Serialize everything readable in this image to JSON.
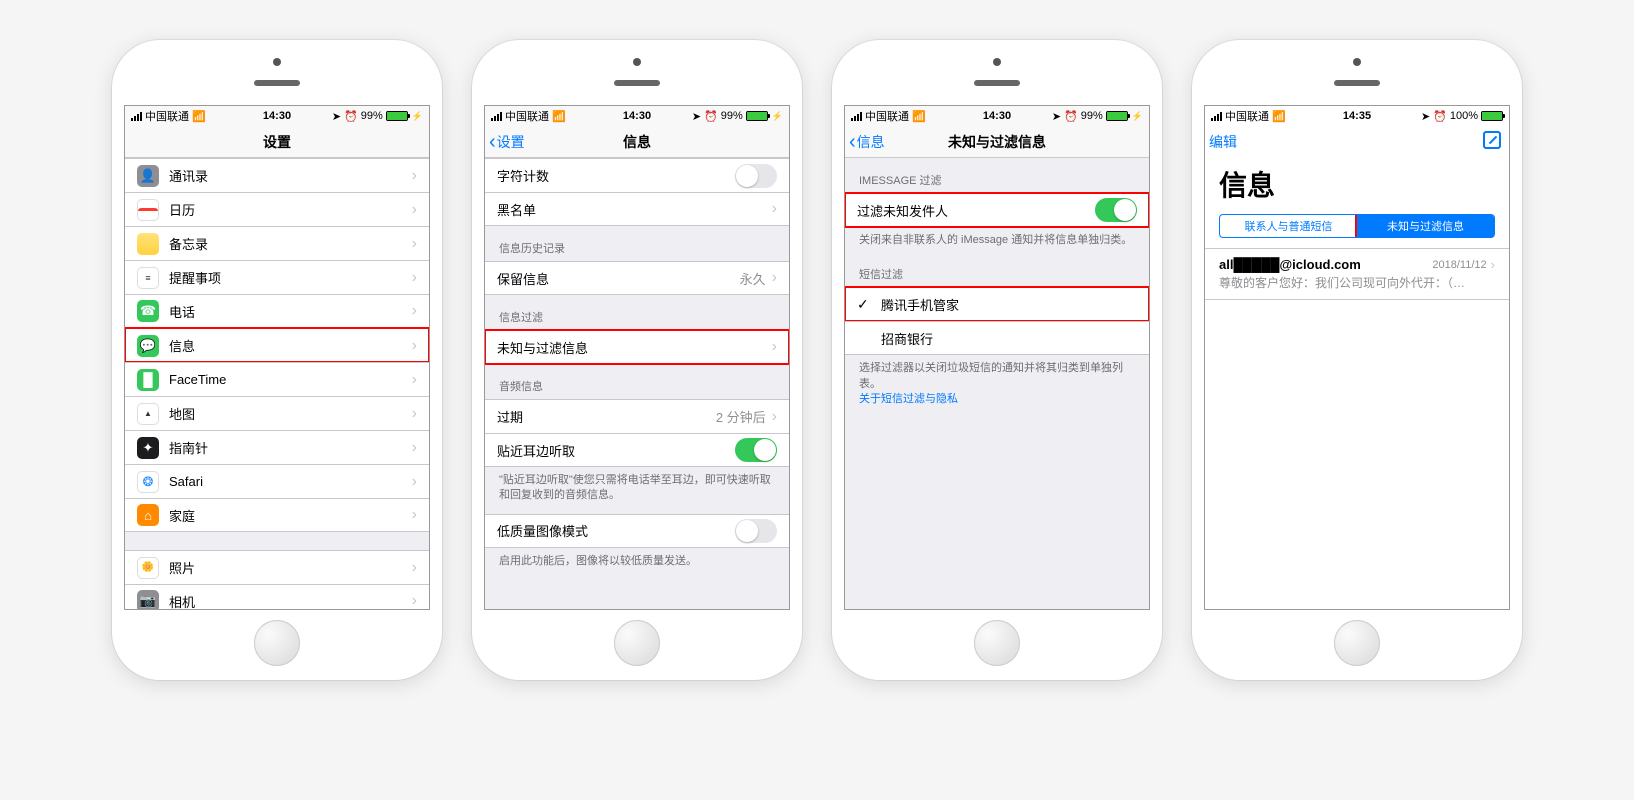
{
  "status": {
    "carrier": "中国联通",
    "time1": "14:30",
    "time4": "14:35",
    "battery1": "99%",
    "battery4": "100%"
  },
  "screen1": {
    "title": "设置",
    "items": [
      {
        "label": "通讯录"
      },
      {
        "label": "日历"
      },
      {
        "label": "备忘录"
      },
      {
        "label": "提醒事项"
      },
      {
        "label": "电话"
      },
      {
        "label": "信息"
      },
      {
        "label": "FaceTime"
      },
      {
        "label": "地图"
      },
      {
        "label": "指南针"
      },
      {
        "label": "Safari"
      },
      {
        "label": "家庭"
      },
      {
        "label": "照片"
      },
      {
        "label": "相机"
      }
    ]
  },
  "screen2": {
    "back": "设置",
    "title": "信息",
    "charCount": "字符计数",
    "blacklist": "黑名单",
    "historyHeader": "信息历史记录",
    "keepMessages": "保留信息",
    "keepValue": "永久",
    "filterHeader": "信息过滤",
    "unknownFilter": "未知与过滤信息",
    "audioHeader": "音频信息",
    "expire": "过期",
    "expireValue": "2 分钟后",
    "raiseListen": "贴近耳边听取",
    "raiseNote": "\"贴近耳边听取\"使您只需将电话举至耳边，即可快速听取和回复收到的音频信息。",
    "lowQuality": "低质量图像模式",
    "lowQualityNote": "启用此功能后，图像将以较低质量发送。"
  },
  "screen3": {
    "back": "信息",
    "title": "未知与过滤信息",
    "imsgHeader": "IMESSAGE 过滤",
    "filterUnknown": "过滤未知发件人",
    "filterNote": "关闭来自非联系人的 iMessage 通知并将信息单独归类。",
    "smsHeader": "短信过滤",
    "tencent": "腾讯手机管家",
    "cmb": "招商银行",
    "smsNote": "选择过滤器以关闭垃圾短信的通知并将其归类到单独列表。",
    "smsLink": "关于短信过滤与隐私"
  },
  "screen4": {
    "edit": "编辑",
    "title": "信息",
    "seg1": "联系人与普通短信",
    "seg2": "未知与过滤信息",
    "msgFrom": "all█████@icloud.com",
    "msgDate": "2018/11/12",
    "msgPreview": "尊敬的客户您好：我们公司现可向外代开：（…"
  }
}
